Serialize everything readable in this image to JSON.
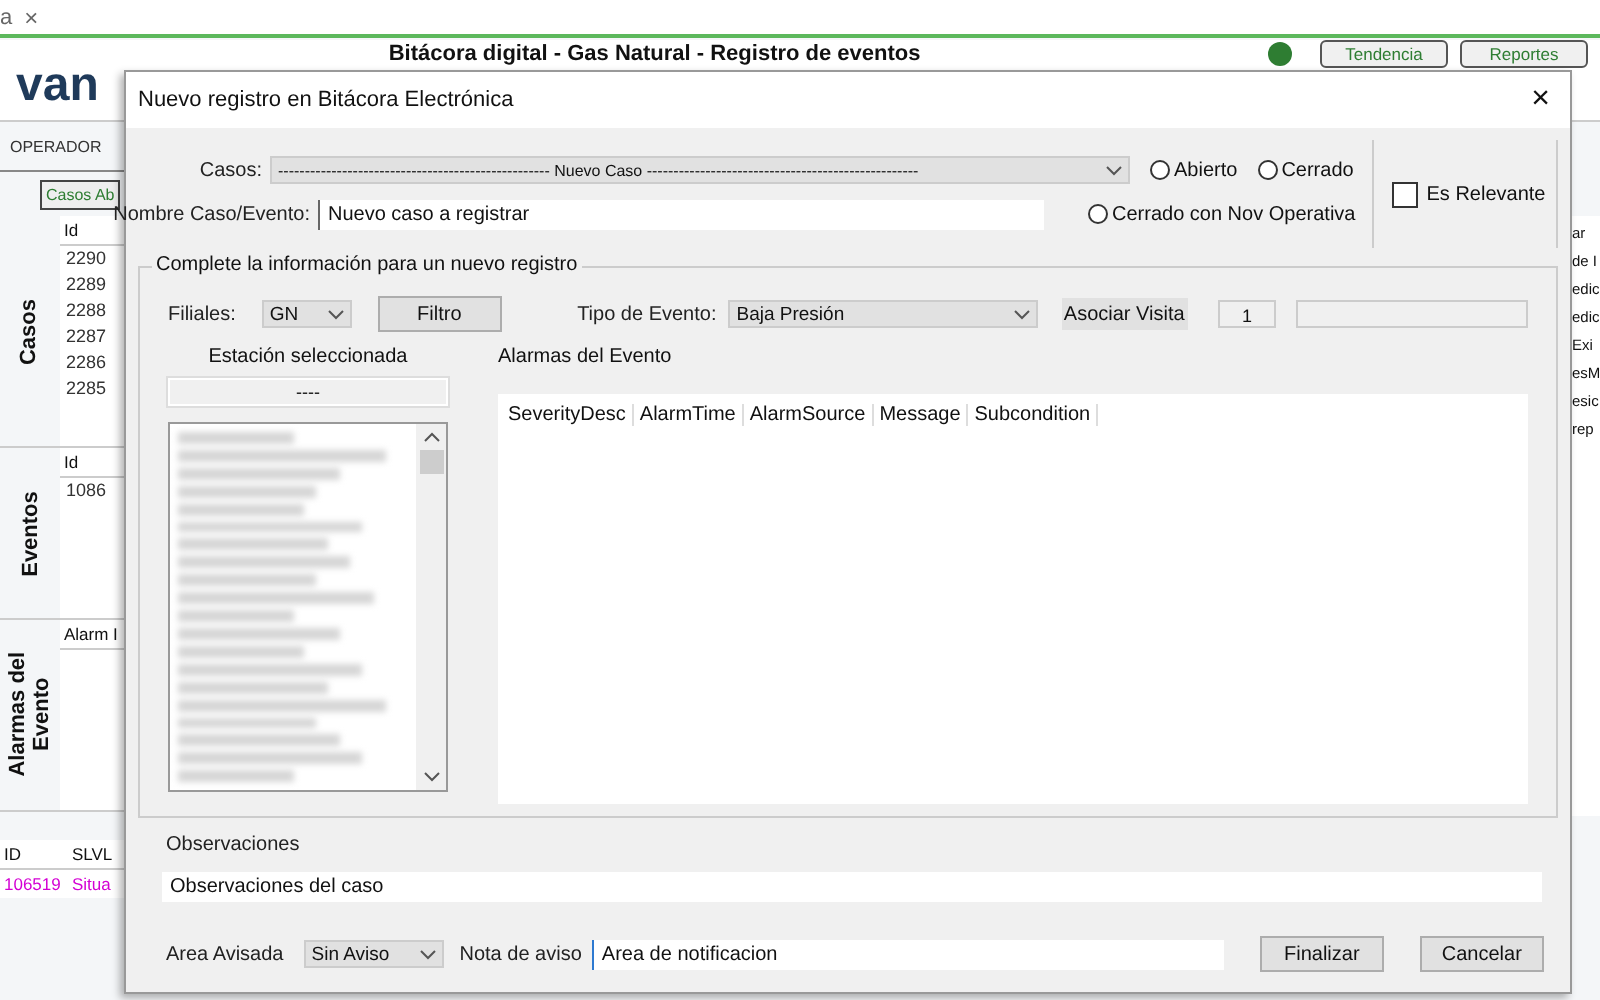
{
  "browser_tab": {
    "label": "a",
    "close": "×"
  },
  "app": {
    "logo": "van",
    "title": "Bitácora digital - Gas Natural - Registro de eventos",
    "buttons": [
      "Tendencia",
      "Reportes"
    ],
    "user_menu": "OPERADOR",
    "tab": "Casos Ab"
  },
  "sections": [
    {
      "label": "Casos",
      "column": "Id",
      "rows": [
        "2290",
        "2289",
        "2288",
        "2287",
        "2286",
        "2285"
      ]
    },
    {
      "label": "Eventos",
      "column": "Id",
      "rows": [
        "1086"
      ]
    },
    {
      "label": "Alarmas del Evento",
      "column": "Alarm I"
    }
  ],
  "right_fragments": [
    {
      "text": "ar"
    },
    {
      "text": "de I"
    },
    {
      "text": "edic"
    },
    {
      "text": "edic"
    },
    {
      "text": "Exi"
    },
    {
      "text": "esM"
    },
    {
      "text": "esic"
    },
    {
      "text": "rep"
    }
  ],
  "bottom_table": {
    "columns": [
      "ID",
      "SLVL"
    ],
    "rows": [
      [
        "106519",
        "Situa"
      ]
    ]
  },
  "dialog": {
    "title": "Nuevo registro en Bitácora Electrónica",
    "close": "×",
    "casos": {
      "label": "Casos:",
      "value": "--------------------------------------------------- Nuevo Caso ---------------------------------------------------"
    },
    "status_options": [
      {
        "label": "Abierto",
        "selected": false
      },
      {
        "label": "Cerrado",
        "selected": false
      },
      {
        "label": "Cerrado con Nov Operativa",
        "selected": false
      }
    ],
    "relevant": {
      "label": "Es Relevante",
      "checked": false
    },
    "name": {
      "label": "Nombre Caso/Evento:",
      "value": "Nuevo caso a registrar"
    },
    "group_title": "Complete la información para un nuevo registro",
    "filiales": {
      "label": "Filiales:",
      "value": "GN"
    },
    "filter_button": "Filtro",
    "event_type": {
      "label": "Tipo de Evento:",
      "value": "Baja Presión"
    },
    "visit_button": "Asociar Visita",
    "visit_count": "1",
    "station": {
      "label": "Estación seleccionada",
      "value": "----"
    },
    "alarms": {
      "label": "Alarmas del Evento",
      "columns": [
        "SeverityDesc",
        "AlarmTime",
        "AlarmSource",
        "Message",
        "Subcondition"
      ]
    },
    "observations": {
      "label": "Observaciones",
      "value": "Observaciones del caso"
    },
    "area": {
      "label": "Area Avisada",
      "value": "Sin Aviso"
    },
    "note": {
      "label": "Nota de aviso",
      "value": "Area de notificacion"
    },
    "buttons": [
      "Finalizar",
      "Cancelar"
    ]
  }
}
